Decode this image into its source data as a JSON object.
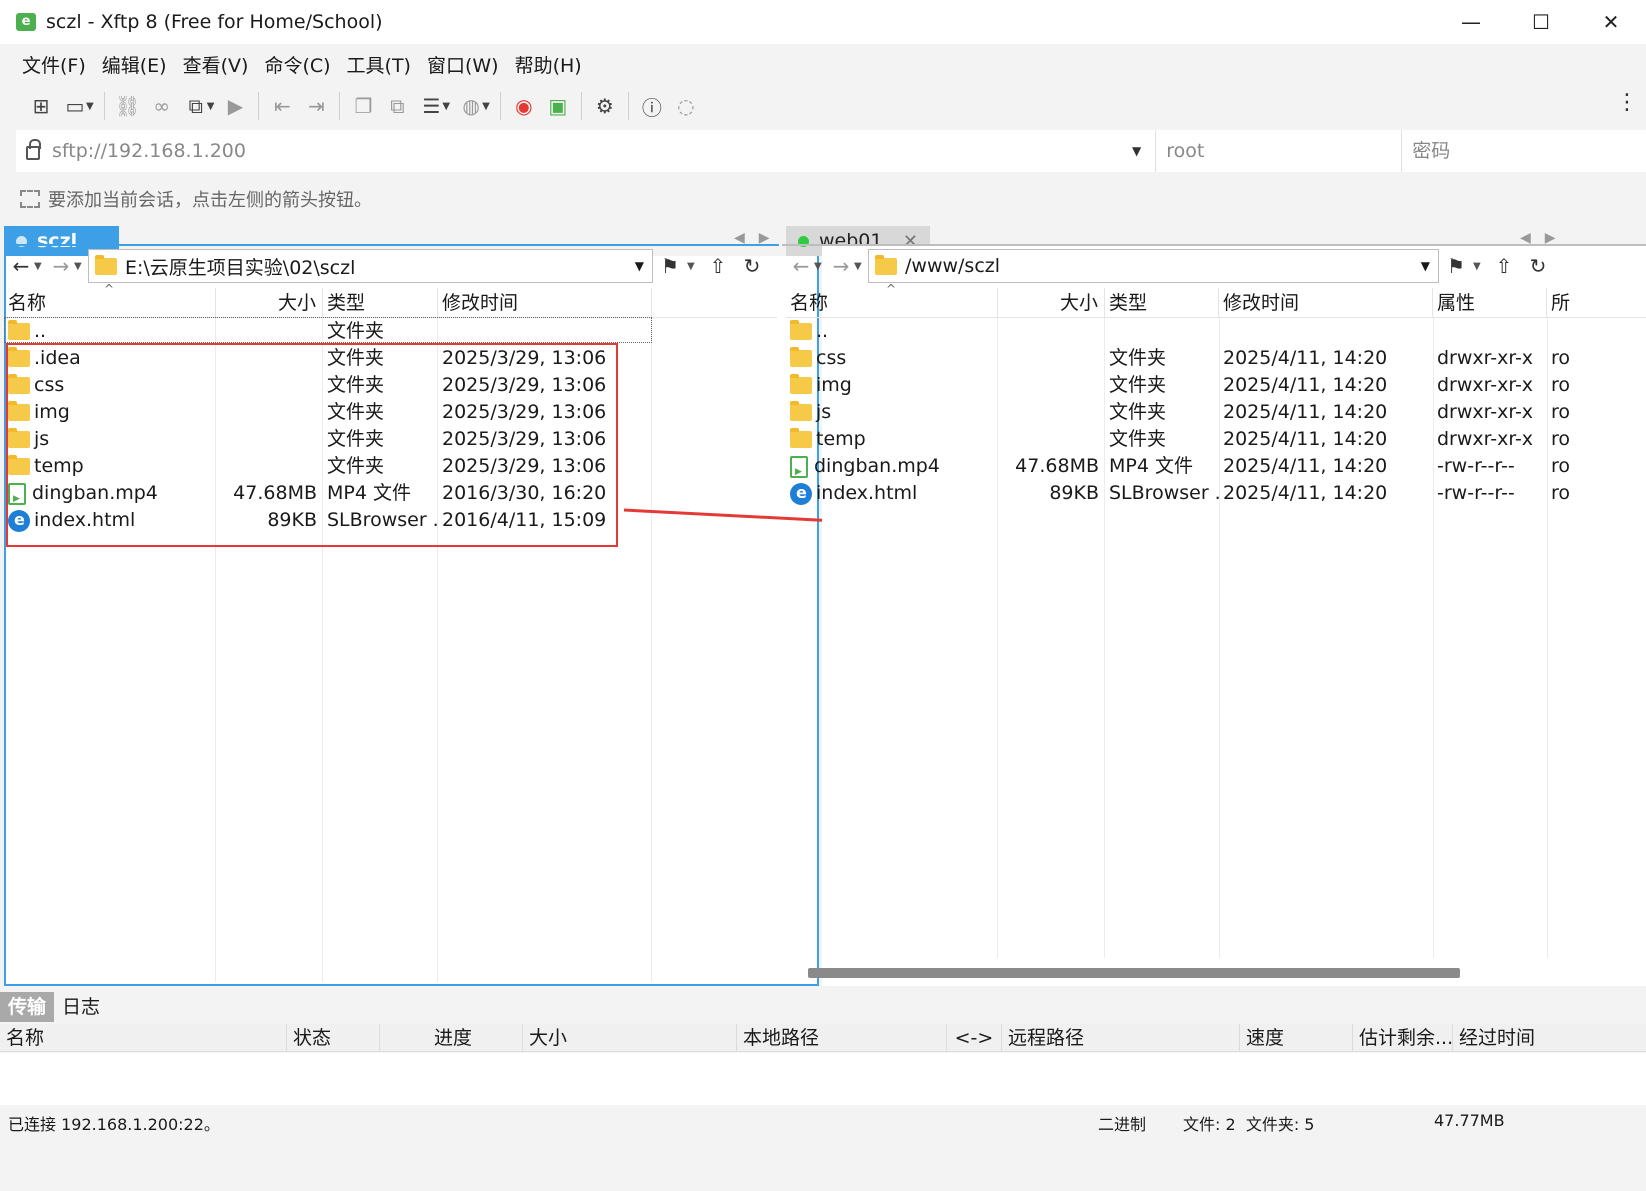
{
  "window": {
    "title": "sczl - Xftp 8 (Free for Home/School)",
    "controls": {
      "minimize": "—",
      "maximize": "☐",
      "close": "✕"
    }
  },
  "menu": [
    "文件(F)",
    "编辑(E)",
    "查看(V)",
    "命令(C)",
    "工具(T)",
    "窗口(W)",
    "帮助(H)"
  ],
  "toolbar": {
    "icons": [
      "new-session-icon",
      "open-folder-icon",
      "disconnect-icon",
      "reconnect-icon",
      "new-tab-icon",
      "play-icon",
      "transfer-left-icon",
      "transfer-right-icon",
      "copy-icon",
      "duplicate-icon",
      "list-view-icon",
      "globe-icon",
      "xshell-icon",
      "xftp-icon",
      "settings-icon",
      "help-icon",
      "chat-icon"
    ]
  },
  "address": {
    "url": "sftp://192.168.1.200",
    "username_placeholder": "root",
    "password_placeholder": "密码"
  },
  "hint": "要添加当前会话，点击左侧的箭头按钮。",
  "left_pane": {
    "tab_label": "sczl",
    "path": "E:\\云原生项目实验\\02\\sczl",
    "columns": [
      "名称",
      "大小",
      "类型",
      "修改时间"
    ],
    "rows": [
      {
        "name": "..",
        "size": "",
        "type": "文件夹",
        "modified": "",
        "icon": "folder"
      },
      {
        "name": ".idea",
        "size": "",
        "type": "文件夹",
        "modified": "2025/3/29, 13:06",
        "icon": "folder"
      },
      {
        "name": "css",
        "size": "",
        "type": "文件夹",
        "modified": "2025/3/29, 13:06",
        "icon": "folder"
      },
      {
        "name": "img",
        "size": "",
        "type": "文件夹",
        "modified": "2025/3/29, 13:06",
        "icon": "folder"
      },
      {
        "name": "js",
        "size": "",
        "type": "文件夹",
        "modified": "2025/3/29, 13:06",
        "icon": "folder"
      },
      {
        "name": "temp",
        "size": "",
        "type": "文件夹",
        "modified": "2025/3/29, 13:06",
        "icon": "folder"
      },
      {
        "name": "dingban.mp4",
        "size": "47.68MB",
        "type": "MP4 文件",
        "modified": "2016/3/30, 16:20",
        "icon": "mp4"
      },
      {
        "name": "index.html",
        "size": "89KB",
        "type": "SLBrowser ...",
        "modified": "2016/4/11, 15:09",
        "icon": "html"
      }
    ]
  },
  "right_pane": {
    "tab_label": "web01",
    "path": "/www/sczl",
    "columns": [
      "名称",
      "大小",
      "类型",
      "修改时间",
      "属性",
      "所"
    ],
    "rows": [
      {
        "name": "..",
        "size": "",
        "type": "",
        "modified": "",
        "attr": "",
        "owner": "",
        "icon": "folder"
      },
      {
        "name": "css",
        "size": "",
        "type": "文件夹",
        "modified": "2025/4/11, 14:20",
        "attr": "drwxr-xr-x",
        "owner": "ro",
        "icon": "folder"
      },
      {
        "name": "img",
        "size": "",
        "type": "文件夹",
        "modified": "2025/4/11, 14:20",
        "attr": "drwxr-xr-x",
        "owner": "ro",
        "icon": "folder"
      },
      {
        "name": "js",
        "size": "",
        "type": "文件夹",
        "modified": "2025/4/11, 14:20",
        "attr": "drwxr-xr-x",
        "owner": "ro",
        "icon": "folder"
      },
      {
        "name": "temp",
        "size": "",
        "type": "文件夹",
        "modified": "2025/4/11, 14:20",
        "attr": "drwxr-xr-x",
        "owner": "ro",
        "icon": "folder"
      },
      {
        "name": "dingban.mp4",
        "size": "47.68MB",
        "type": "MP4 文件",
        "modified": "2025/4/11, 14:20",
        "attr": "-rw-r--r--",
        "owner": "ro",
        "icon": "mp4"
      },
      {
        "name": "index.html",
        "size": "89KB",
        "type": "SLBrowser ...",
        "modified": "2025/4/11, 14:20",
        "attr": "-rw-r--r--",
        "owner": "ro",
        "icon": "html"
      }
    ]
  },
  "bottom_tabs": [
    "传输",
    "日志"
  ],
  "transfer_columns": [
    "名称",
    "状态",
    "进度",
    "大小",
    "本地路径",
    "<->",
    "远程路径",
    "速度",
    "估计剩余...",
    "经过时间"
  ],
  "status": {
    "connection": "已连接 192.168.1.200:22。",
    "mode": "二进制",
    "counts": "文件: 2  文件夹: 5",
    "total": "47.77MB"
  },
  "colors": {
    "accent": "#3da0e6",
    "annotation": "#e53935",
    "folder": "#f7c948",
    "online": "#2ecc40"
  }
}
